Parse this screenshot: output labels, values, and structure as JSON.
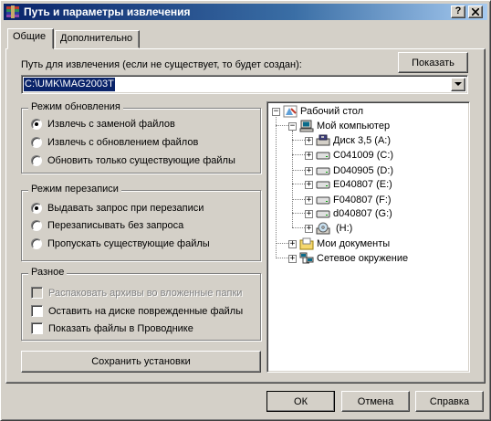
{
  "window": {
    "title": "Путь и параметры извлечения",
    "help_button": "?",
    "close_button": "×"
  },
  "tabs": [
    {
      "label": "Общие",
      "active": true
    },
    {
      "label": "Дополнительно",
      "active": false
    }
  ],
  "path": {
    "label": "Путь для извлечения (если не существует, то будет создан):",
    "value": "C:\\UMK\\MAG2003T",
    "show_button": "Показать"
  },
  "update_mode": {
    "title": "Режим обновления",
    "options": [
      {
        "label": "Извлечь с заменой файлов",
        "selected": true
      },
      {
        "label": "Извлечь с обновлением файлов",
        "selected": false
      },
      {
        "label": "Обновить только существующие файлы",
        "selected": false
      }
    ]
  },
  "overwrite_mode": {
    "title": "Режим перезаписи",
    "options": [
      {
        "label": "Выдавать запрос при перезаписи",
        "selected": true
      },
      {
        "label": "Перезаписывать без запроса",
        "selected": false
      },
      {
        "label": "Пропускать существующие файлы",
        "selected": false
      }
    ]
  },
  "misc": {
    "title": "Разное",
    "options": [
      {
        "label": "Распаковать архивы во вложенные папки",
        "checked": false,
        "enabled": false
      },
      {
        "label": "Оставить на диске поврежденные файлы",
        "checked": false,
        "enabled": true
      },
      {
        "label": "Показать файлы в Проводнике",
        "checked": false,
        "enabled": true
      }
    ]
  },
  "save_button": "Сохранить установки",
  "tree": {
    "desktop": "Рабочий стол",
    "computer": "Мой компьютер",
    "drives": [
      {
        "label": "Диск 3,5 (A:)",
        "icon": "floppy-drive-icon"
      },
      {
        "label": "C041009 (C:)",
        "icon": "hard-drive-icon"
      },
      {
        "label": "D040905 (D:)",
        "icon": "hard-drive-icon"
      },
      {
        "label": "E040807 (E:)",
        "icon": "hard-drive-icon"
      },
      {
        "label": "F040807 (F:)",
        "icon": "hard-drive-icon"
      },
      {
        "label": "d040807 (G:)",
        "icon": "hard-drive-icon"
      },
      {
        "label": "(H:)",
        "icon": "cd-drive-icon"
      }
    ],
    "documents": "Мои документы",
    "network": "Сетевое окружение"
  },
  "footer": {
    "ok": "ОК",
    "cancel": "Отмена",
    "help": "Справка"
  }
}
